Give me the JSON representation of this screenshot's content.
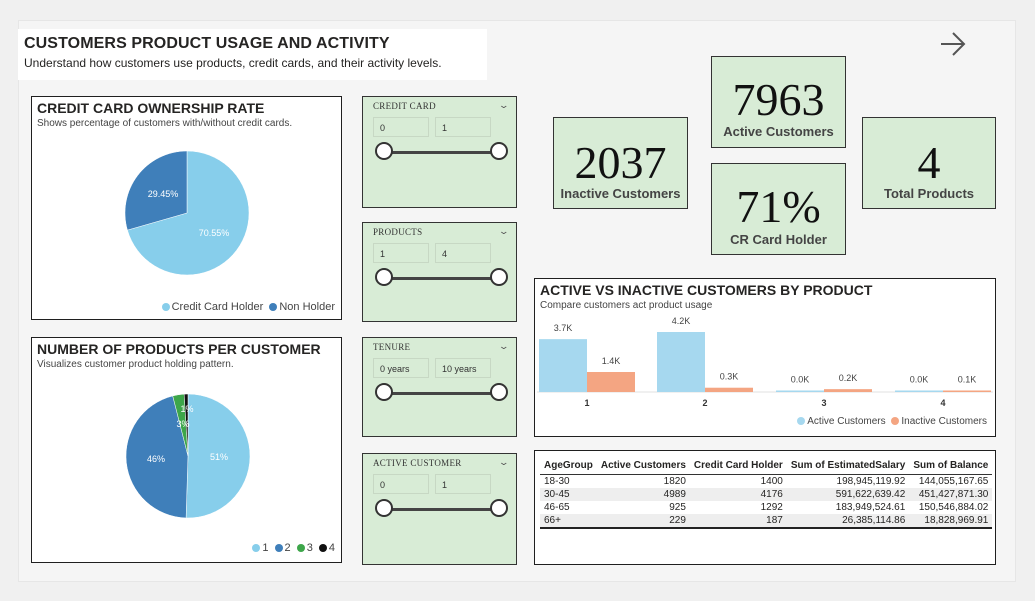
{
  "header": {
    "title": "CUSTOMERS PRODUCT USAGE AND ACTIVITY",
    "subtitle": "Understand how customers use products, credit cards, and their activity levels."
  },
  "icons": {
    "nav": "arrow-right-icon"
  },
  "colors": {
    "light_blue": "#87ceeb",
    "dark_blue": "#3f7fba",
    "green": "#3da64a",
    "black": "#111111",
    "salmon": "#f4a582",
    "kpi_bg": "#d8ecd6"
  },
  "credit_card_ownership": {
    "title": "CREDIT CARD OWNERSHIP RATE",
    "subtitle": "Shows percentage of customers with/without credit cards.",
    "legend": [
      "Credit Card Holder",
      "Non Holder"
    ],
    "chart_data": {
      "type": "pie",
      "categories": [
        "Credit Card Holder",
        "Non Holder"
      ],
      "values": [
        70.55,
        29.45
      ],
      "labels": [
        "70.55%",
        "29.45%"
      ],
      "legend": "bottom-right"
    }
  },
  "products_per_customer": {
    "title": "NUMBER OF PRODUCTS PER CUSTOMER",
    "subtitle": "Visualizes customer product holding pattern.",
    "legend": [
      "1",
      "2",
      "3",
      "4"
    ],
    "chart_data": {
      "type": "pie",
      "categories": [
        "1",
        "2",
        "3",
        "4"
      ],
      "values": [
        51,
        46,
        3,
        1
      ],
      "labels": [
        "51%",
        "46%",
        "3%",
        "1%"
      ],
      "legend": "bottom-right"
    }
  },
  "slicers": [
    {
      "label": "CREDIT CARD",
      "min": "0",
      "max": "1"
    },
    {
      "label": "PRODUCTS",
      "min": "1",
      "max": "4"
    },
    {
      "label": "TENURE",
      "min": "0 years",
      "max": "10 years"
    },
    {
      "label": "ACTIVE CUSTOMER",
      "min": "0",
      "max": "1"
    }
  ],
  "kpis": {
    "active": {
      "value": "7963",
      "label": "Active Customers"
    },
    "inactive": {
      "value": "2037",
      "label": "Inactive Customers"
    },
    "total_products": {
      "value": "4",
      "label": "Total Products"
    },
    "cr_card": {
      "value": "71%",
      "label": "CR Card Holder"
    }
  },
  "active_vs_inactive": {
    "title": "ACTIVE VS INACTIVE CUSTOMERS BY PRODUCT",
    "subtitle": "Compare customers act product usage",
    "chart_data": {
      "type": "bar",
      "categories": [
        "1",
        "2",
        "3",
        "4"
      ],
      "series": [
        {
          "name": "Active Customers",
          "values": [
            3700,
            4200,
            0,
            0
          ],
          "labels": [
            "3.7K",
            "4.2K",
            "0.0K",
            "0.0K"
          ]
        },
        {
          "name": "Inactive Customers",
          "values": [
            1400,
            300,
            200,
            100
          ],
          "labels": [
            "1.4K",
            "0.3K",
            "0.2K",
            "0.1K"
          ]
        }
      ],
      "legend": "bottom-right"
    }
  },
  "table": {
    "columns": [
      "AgeGroup",
      "Active Customers",
      "Credit Card Holder",
      "Sum of EstimatedSalary",
      "Sum of Balance"
    ],
    "rows": [
      [
        "18-30",
        "1820",
        "1400",
        "198,945,119.92",
        "144,055,167.65"
      ],
      [
        "30-45",
        "4989",
        "4176",
        "591,622,639.42",
        "451,427,871.30"
      ],
      [
        "46-65",
        "925",
        "1292",
        "183,949,524.61",
        "150,546,884.02"
      ],
      [
        "66+",
        "229",
        "187",
        "26,385,114.86",
        "18,828,969.91"
      ]
    ]
  }
}
